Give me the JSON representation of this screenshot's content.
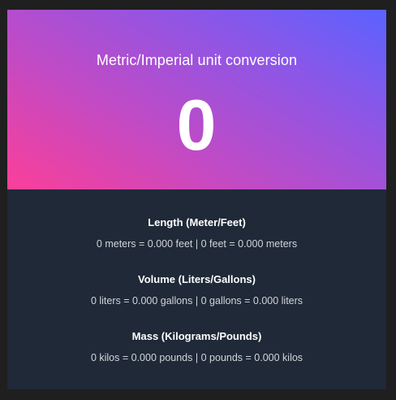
{
  "header": {
    "title": "Metric/Imperial unit conversion",
    "input_value": "0"
  },
  "sections": [
    {
      "title": "Length (Meter/Feet)",
      "left": "0 meters = 0.000 feet",
      "separator": "|",
      "right": "0 feet = 0.000 meters"
    },
    {
      "title": "Volume (Liters/Gallons)",
      "left": "0 liters = 0.000 gallons",
      "separator": "|",
      "right": "0 gallons = 0.000 liters"
    },
    {
      "title": "Mass (Kilograms/Pounds)",
      "left": "0 kilos = 0.000 pounds",
      "separator": "|",
      "right": "0 pounds = 0.000 kilos"
    }
  ],
  "colors": {
    "gradient_start": "#fb3f99",
    "gradient_end": "#5a62ff",
    "panel_bg": "#1f2937",
    "page_bg": "#1f1f1f"
  }
}
